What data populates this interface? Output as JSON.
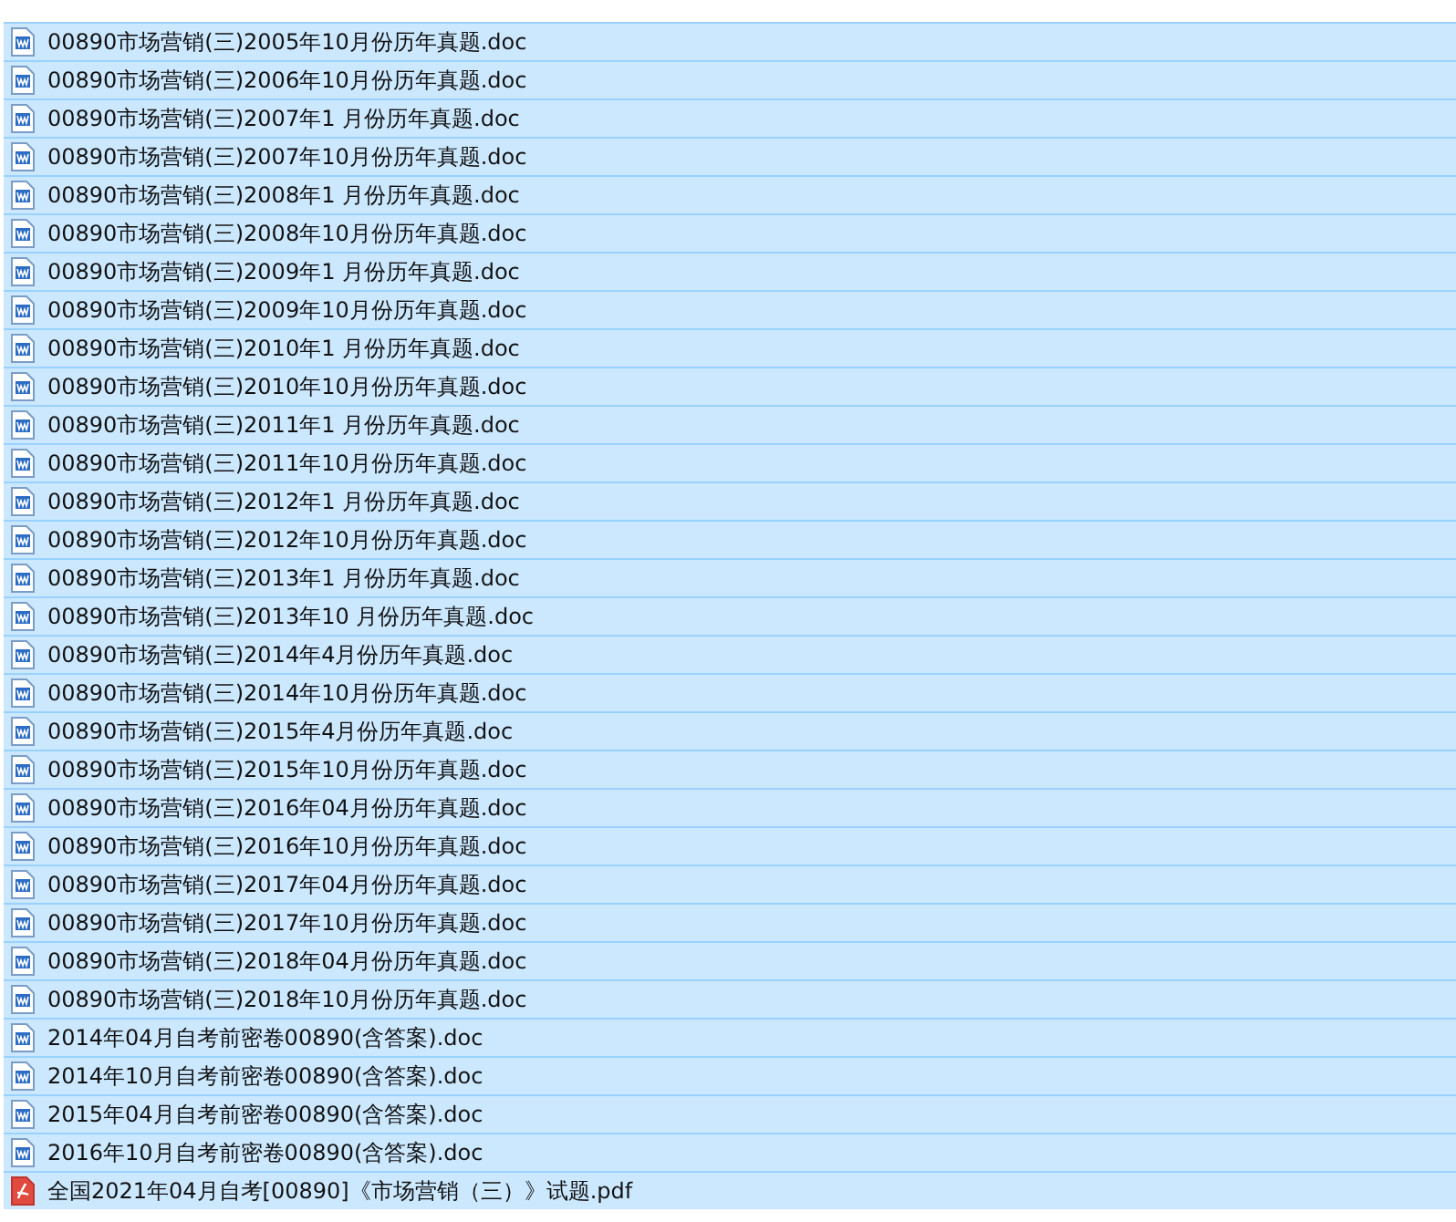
{
  "files": [
    {
      "name": "00890市场营销(三)2005年10月份历年真题.doc",
      "kind": "doc",
      "selected": true
    },
    {
      "name": "00890市场营销(三)2006年10月份历年真题.doc",
      "kind": "doc",
      "selected": true
    },
    {
      "name": "00890市场营销(三)2007年1 月份历年真题.doc",
      "kind": "doc",
      "selected": true
    },
    {
      "name": "00890市场营销(三)2007年10月份历年真题.doc",
      "kind": "doc",
      "selected": true
    },
    {
      "name": "00890市场营销(三)2008年1 月份历年真题.doc",
      "kind": "doc",
      "selected": true
    },
    {
      "name": "00890市场营销(三)2008年10月份历年真题.doc",
      "kind": "doc",
      "selected": true
    },
    {
      "name": "00890市场营销(三)2009年1 月份历年真题.doc",
      "kind": "doc",
      "selected": true
    },
    {
      "name": "00890市场营销(三)2009年10月份历年真题.doc",
      "kind": "doc",
      "selected": true
    },
    {
      "name": "00890市场营销(三)2010年1 月份历年真题.doc",
      "kind": "doc",
      "selected": true
    },
    {
      "name": "00890市场营销(三)2010年10月份历年真题.doc",
      "kind": "doc",
      "selected": true
    },
    {
      "name": "00890市场营销(三)2011年1 月份历年真题.doc",
      "kind": "doc",
      "selected": true
    },
    {
      "name": "00890市场营销(三)2011年10月份历年真题.doc",
      "kind": "doc",
      "selected": true
    },
    {
      "name": "00890市场营销(三)2012年1 月份历年真题.doc",
      "kind": "doc",
      "selected": true
    },
    {
      "name": "00890市场营销(三)2012年10月份历年真题.doc",
      "kind": "doc",
      "selected": true
    },
    {
      "name": "00890市场营销(三)2013年1 月份历年真题.doc",
      "kind": "doc",
      "selected": true
    },
    {
      "name": "00890市场营销(三)2013年10 月份历年真题.doc",
      "kind": "doc",
      "selected": true
    },
    {
      "name": "00890市场营销(三)2014年4月份历年真题.doc",
      "kind": "doc",
      "selected": true
    },
    {
      "name": "00890市场营销(三)2014年10月份历年真题.doc",
      "kind": "doc",
      "selected": true
    },
    {
      "name": "00890市场营销(三)2015年4月份历年真题.doc",
      "kind": "doc",
      "selected": true
    },
    {
      "name": "00890市场营销(三)2015年10月份历年真题.doc",
      "kind": "doc",
      "selected": true
    },
    {
      "name": "00890市场营销(三)2016年04月份历年真题.doc",
      "kind": "doc",
      "selected": true
    },
    {
      "name": "00890市场营销(三)2016年10月份历年真题.doc",
      "kind": "doc",
      "selected": true
    },
    {
      "name": "00890市场营销(三)2017年04月份历年真题.doc",
      "kind": "doc",
      "selected": true
    },
    {
      "name": "00890市场营销(三)2017年10月份历年真题.doc",
      "kind": "doc",
      "selected": true
    },
    {
      "name": "00890市场营销(三)2018年04月份历年真题.doc",
      "kind": "doc",
      "selected": true
    },
    {
      "name": "00890市场营销(三)2018年10月份历年真题.doc",
      "kind": "doc",
      "selected": true
    },
    {
      "name": "2014年04月自考前密卷00890(含答案).doc",
      "kind": "doc",
      "selected": true
    },
    {
      "name": "2014年10月自考前密卷00890(含答案).doc",
      "kind": "doc",
      "selected": true
    },
    {
      "name": "2015年04月自考前密卷00890(含答案).doc",
      "kind": "doc",
      "selected": true
    },
    {
      "name": "2016年10月自考前密卷00890(含答案).doc",
      "kind": "doc",
      "selected": true
    },
    {
      "name": "全国2021年04月自考[00890]《市场营销（三）》试题.pdf",
      "kind": "pdf",
      "selected": true
    }
  ]
}
